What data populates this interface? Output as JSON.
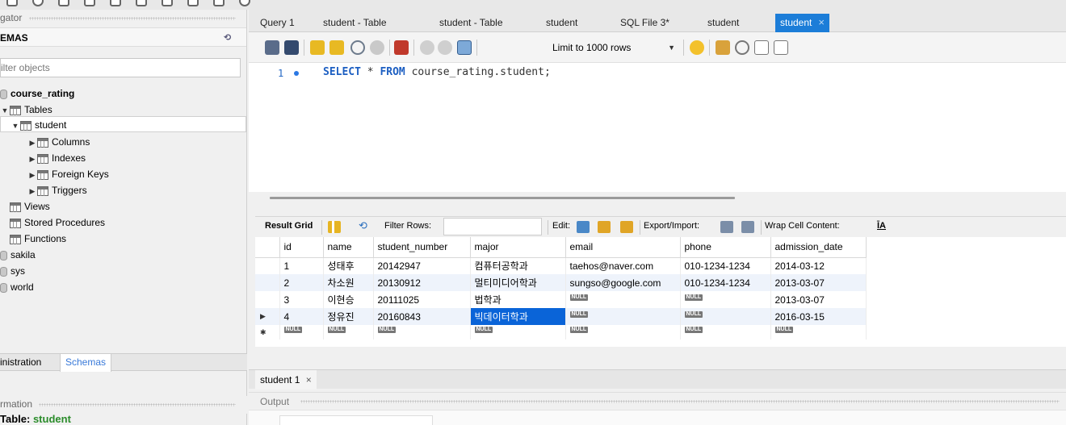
{
  "navigator": {
    "title": "gator",
    "schemas_header": "EMAS",
    "filter_placeholder": "ilter objects",
    "tree": {
      "course_rating": "course_rating",
      "tables": "Tables",
      "student": "student",
      "columns": "Columns",
      "indexes": "Indexes",
      "foreign_keys": "Foreign Keys",
      "triggers": "Triggers",
      "views": "Views",
      "stored_procedures": "Stored Procedures",
      "functions": "Functions",
      "sakila": "sakila",
      "sys": "sys",
      "world": "world"
    },
    "tabs": {
      "administration": "inistration",
      "schemas": "Schemas"
    },
    "information_title": "rmation",
    "info_table_label": "Table:",
    "info_table_name": "student"
  },
  "query_tabs": [
    {
      "label": "Query 1"
    },
    {
      "label": "student - Table"
    },
    {
      "label": "student - Table"
    },
    {
      "label": "student"
    },
    {
      "label": "SQL File 3*"
    },
    {
      "label": "student"
    },
    {
      "label": "student",
      "close": "×"
    }
  ],
  "toolbar": {
    "limit": "Limit to 1000 rows"
  },
  "editor": {
    "line_number": "1",
    "sql": {
      "kw1": "SELECT",
      "star": " * ",
      "kw2": "FROM",
      "rest": " course_rating.student;"
    }
  },
  "result_toolbar": {
    "result_grid": "Result Grid",
    "filter_rows": "Filter Rows:",
    "edit": "Edit:",
    "export_import": "Export/Import:",
    "wrap_cell": "Wrap Cell Content:",
    "wrap_icon": "ĪA"
  },
  "grid": {
    "columns": [
      "id",
      "name",
      "student_number",
      "major",
      "email",
      "phone",
      "admission_date"
    ],
    "rows": [
      [
        "1",
        "성태후",
        "20142947",
        "컴퓨터공학과",
        "taehos@naver.com",
        "010-1234-1234",
        "2014-03-12"
      ],
      [
        "2",
        "차소원",
        "20130912",
        "멀티미디어학과",
        "sungso@google.com",
        "010-1234-1234",
        "2013-03-07"
      ],
      [
        "3",
        "이현승",
        "20111025",
        "법학과",
        "NULL",
        "NULL",
        "2013-03-07"
      ],
      [
        "4",
        "정유진",
        "20160843",
        "빅데이터학과",
        "NULL",
        "NULL",
        "2016-03-15"
      ]
    ],
    "null_label": "NULL"
  },
  "result_tab": {
    "label": "student 1",
    "close": "×"
  },
  "output": {
    "title": "Output"
  },
  "colors": {
    "accent": "#1c7dd8",
    "selection": "#0a64d8",
    "keyword": "#1d5fc2"
  }
}
